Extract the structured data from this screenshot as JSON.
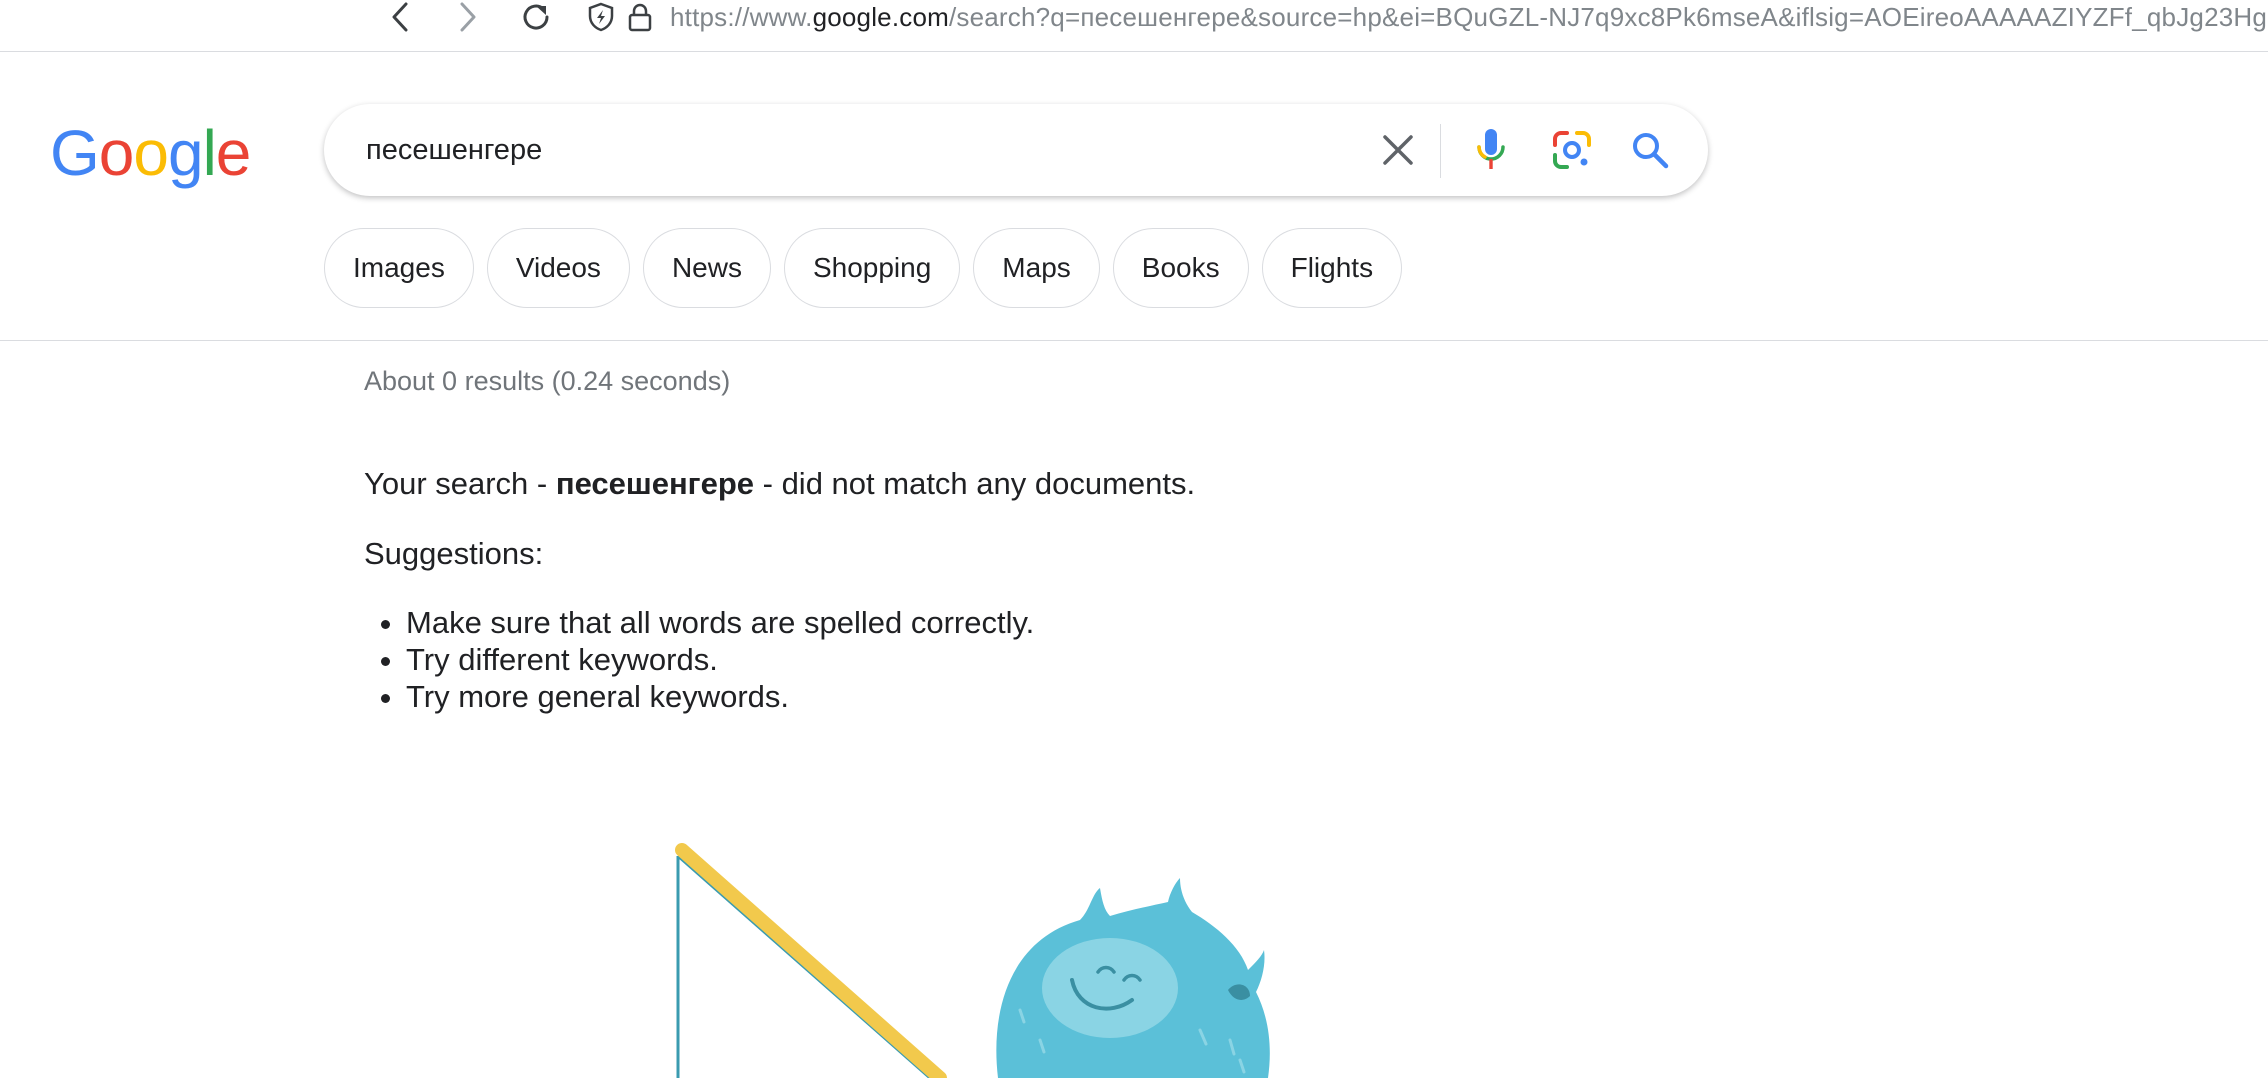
{
  "browser": {
    "url_prefix": "https://www.",
    "url_domain": "google.com",
    "url_rest": "/search?q=песешенгере&source=hp&ei=BQuGZL-NJ7q9xc8Pk6mseA&iflsig=AOEireoAAAAAZIYZFf_qbJg23Hg"
  },
  "header": {
    "logo_letters": [
      "G",
      "o",
      "o",
      "g",
      "l",
      "e"
    ],
    "logo_colors": [
      "#4285F4",
      "#EA4335",
      "#FBBC05",
      "#4285F4",
      "#34A853",
      "#EA4335"
    ]
  },
  "search": {
    "query": "песешенгере"
  },
  "chips": [
    "Images",
    "Videos",
    "News",
    "Shopping",
    "Maps",
    "Books",
    "Flights"
  ],
  "results": {
    "stats": "About 0 results (0.24 seconds)",
    "no_match_prefix": "Your search - ",
    "no_match_query": "песешенгере",
    "no_match_suffix": " - did not match any documents.",
    "suggestions_title": "Suggestions:",
    "suggestions": [
      "Make sure that all words are spelled correctly.",
      "Try different keywords.",
      "Try more general keywords."
    ]
  },
  "colors": {
    "accent_blue": "#4285F4",
    "text": "#202124",
    "muted": "#70757a",
    "border": "#dadce0",
    "creature": "#5bc0d8",
    "fishing_rod": "#f2c94c"
  }
}
